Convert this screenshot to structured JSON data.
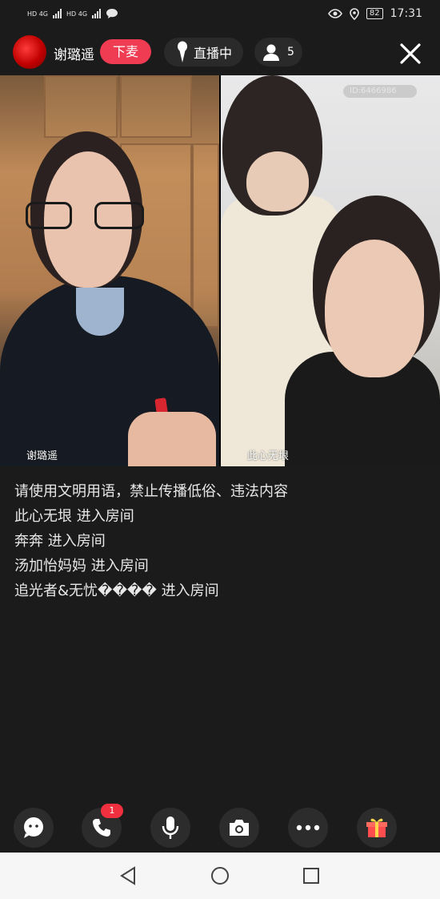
{
  "status_bar": {
    "net_top": "HD 4G",
    "net_bottom": "HD 4G",
    "battery": "82",
    "time": "17:31"
  },
  "header": {
    "host_name": "谢璐遥",
    "leave_label": "下麦",
    "live_label": "直播中",
    "viewer_count": "5"
  },
  "videos": {
    "left_name": "谢璐遥",
    "right_name": "此心无垠",
    "right_watermark": "ID:6466986"
  },
  "chat": {
    "messages": [
      "请使用文明用语，禁止传播低俗、违法内容",
      "此心无垠 进入房间",
      "奔奔 进入房间",
      "汤加怡妈妈 进入房间",
      "追光者&无忧���� 进入房间"
    ]
  },
  "toolbar": {
    "call_badge": "1"
  },
  "colors": {
    "background": "#1b1b1b",
    "accent": "#f03c52",
    "gift": "#ff4d4f"
  }
}
